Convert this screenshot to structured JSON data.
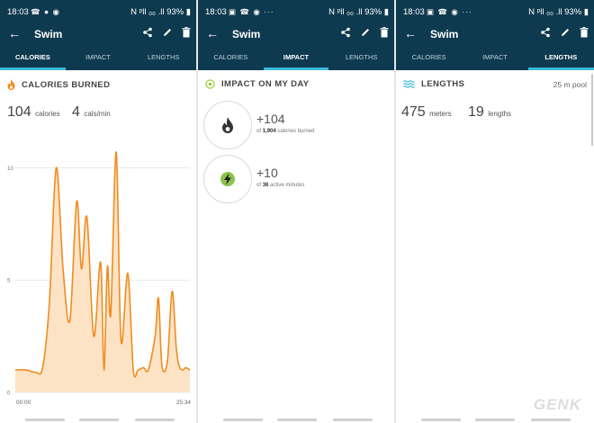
{
  "status": {
    "time": "18:03",
    "signal": "N ᵖll ₀₀ .ll",
    "battery": "93%"
  },
  "panels": [
    {
      "toolbar_title": "Swim",
      "tabs": [
        "CALORIES",
        "IMPACT",
        "LENGTHS"
      ],
      "active": 0
    },
    {
      "toolbar_title": "Swim",
      "tabs": [
        "CALORIES",
        "IMPACT",
        "LENGTHS"
      ],
      "active": 1
    },
    {
      "toolbar_title": "Swim",
      "tabs": [
        "CALORIES",
        "IMPACT",
        "LENGTHS"
      ],
      "active": 2
    }
  ],
  "calories": {
    "heading": "CALORIES BURNED",
    "total_value": "104",
    "total_unit": "calories",
    "rate_value": "4",
    "rate_unit": "cals/min"
  },
  "impact": {
    "heading": "IMPACT ON MY DAY",
    "cal_value": "+104",
    "cal_of": "of",
    "cal_total": "1,904",
    "cal_suffix": "calories burned",
    "active_value": "+10",
    "active_of": "of",
    "active_total": "36",
    "active_suffix": "active minutes"
  },
  "lengths": {
    "heading": "LENGTHS",
    "pool": "25 m pool",
    "meters_value": "475",
    "meters_unit": "meters",
    "lengths_value": "19",
    "lengths_unit": "lengths"
  },
  "watermark": "GENK",
  "colors": {
    "bar": "#0e3a4f",
    "accent": "#3bb8d8",
    "line": "#f08c1e",
    "fill": "#fde3c6"
  },
  "chart_data": {
    "type": "area",
    "x_labels": [
      "00:00",
      "25:34"
    ],
    "yticks": [
      0,
      5,
      10
    ],
    "ylim": [
      0,
      10.5
    ],
    "x_minutes": [
      0,
      1.5,
      3,
      4,
      5,
      6,
      7,
      8,
      9,
      9.7,
      10.5,
      11.5,
      12.5,
      13,
      13.5,
      14,
      14.8,
      15.5,
      16.5,
      17.3,
      18,
      18.8,
      19.5,
      20.5,
      21,
      21.5,
      22.3,
      23,
      23.6,
      24,
      24.5,
      25,
      25.6
    ],
    "values": [
      1.0,
      1.0,
      0.9,
      1.1,
      4.0,
      10.0,
      5.5,
      3.2,
      8.5,
      5.5,
      7.8,
      2.5,
      5.8,
      1.0,
      5.6,
      3.5,
      10.7,
      2.3,
      5.3,
      1.0,
      1.0,
      1.1,
      1.0,
      2.5,
      4.2,
      1.2,
      1.4,
      4.5,
      2.0,
      1.2,
      1.0,
      1.1,
      1.0
    ]
  }
}
